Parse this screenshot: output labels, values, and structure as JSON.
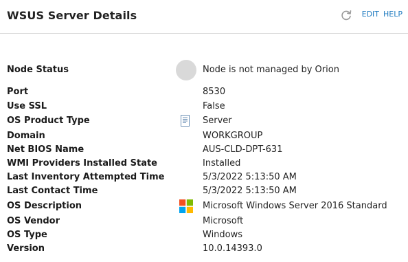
{
  "header": {
    "title": "WSUS Server Details",
    "edit_label": "EDIT",
    "help_label": "HELP"
  },
  "details": [
    {
      "label": "Node Status",
      "value": "Node is not managed by Orion",
      "icon": "status-circle-gray"
    },
    {
      "label": "Port",
      "value": "8530",
      "icon": ""
    },
    {
      "label": "Use SSL",
      "value": "False",
      "icon": ""
    },
    {
      "label": "OS Product Type",
      "value": "Server",
      "icon": "server-document-icon"
    },
    {
      "label": "Domain",
      "value": "WORKGROUP",
      "icon": ""
    },
    {
      "label": "Net BIOS Name",
      "value": "AUS-CLD-DPT-631",
      "icon": ""
    },
    {
      "label": "WMI Providers Installed State",
      "value": "Installed",
      "icon": ""
    },
    {
      "label": "Last Inventory Attempted Time",
      "value": "5/3/2022 5:13:50 AM",
      "icon": ""
    },
    {
      "label": "Last Contact Time",
      "value": "5/3/2022 5:13:50 AM",
      "icon": ""
    },
    {
      "label": "OS Description",
      "value": "Microsoft Windows Server 2016 Standard",
      "icon": "windows-logo-icon"
    },
    {
      "label": "OS Vendor",
      "value": "Microsoft",
      "icon": ""
    },
    {
      "label": "OS Type",
      "value": "Windows",
      "icon": ""
    },
    {
      "label": "Version",
      "value": "10.0.14393.0",
      "icon": ""
    }
  ],
  "colors": {
    "link": "#1f7bc0",
    "status_gray": "#d9d9d9",
    "windows_red": "#f25022",
    "windows_green": "#7fba00",
    "windows_blue": "#00a4ef",
    "windows_yellow": "#ffb900"
  }
}
